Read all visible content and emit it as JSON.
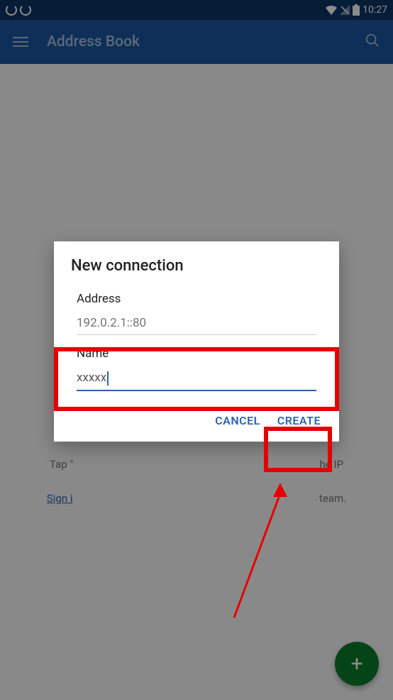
{
  "status": {
    "time": "10:27"
  },
  "appBar": {
    "title": "Address Book"
  },
  "content": {
    "tapHint": "Tap \"",
    "tapHintEnd": "he IP",
    "signin": "Sign i",
    "teamEnd": "team."
  },
  "dialog": {
    "title": "New connection",
    "addressLabel": "Address",
    "addressPlaceholder": "192.0.2.1::80",
    "nameLabel": "Name",
    "nameValue": "xxxxx",
    "cancel": "CANCEL",
    "create": "CREATE"
  },
  "fab": {
    "plus": "+"
  }
}
